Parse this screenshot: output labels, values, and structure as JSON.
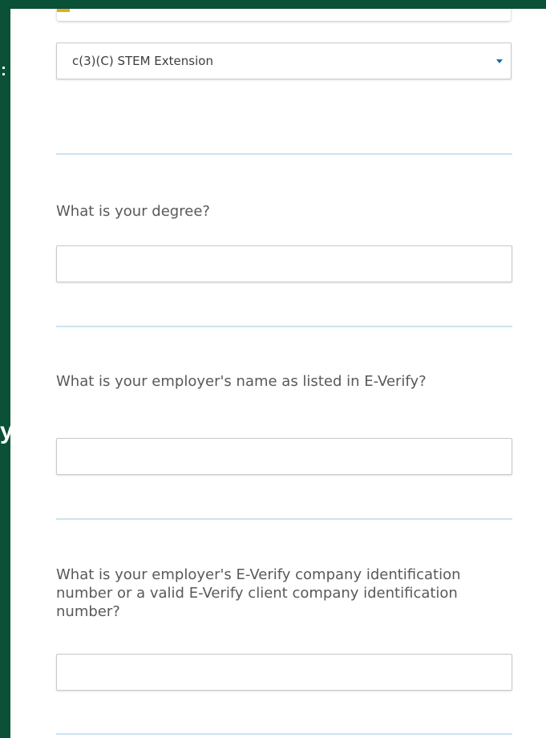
{
  "colors": {
    "frame_background": "#0a5137",
    "panel_background": "#ffffff",
    "divider": "#cde3f0",
    "select_caret": "#0f6fa8",
    "question_text": "#595959",
    "previous_field_marker": "#e3a92b"
  },
  "left_edge": {
    "colon_fragment": ":",
    "y_fragment": "y"
  },
  "eligibility_select": {
    "selected_value": "c(3)(C) STEM Extension",
    "icon": "chevron-down-icon"
  },
  "questions": [
    {
      "label": "What is your degree?",
      "value": ""
    },
    {
      "label": "What is your employer's name as listed in E-Verify?",
      "value": ""
    },
    {
      "label": "What is your employer's E-Verify company identification number or a valid E-Verify client company identification number?",
      "value": ""
    }
  ]
}
